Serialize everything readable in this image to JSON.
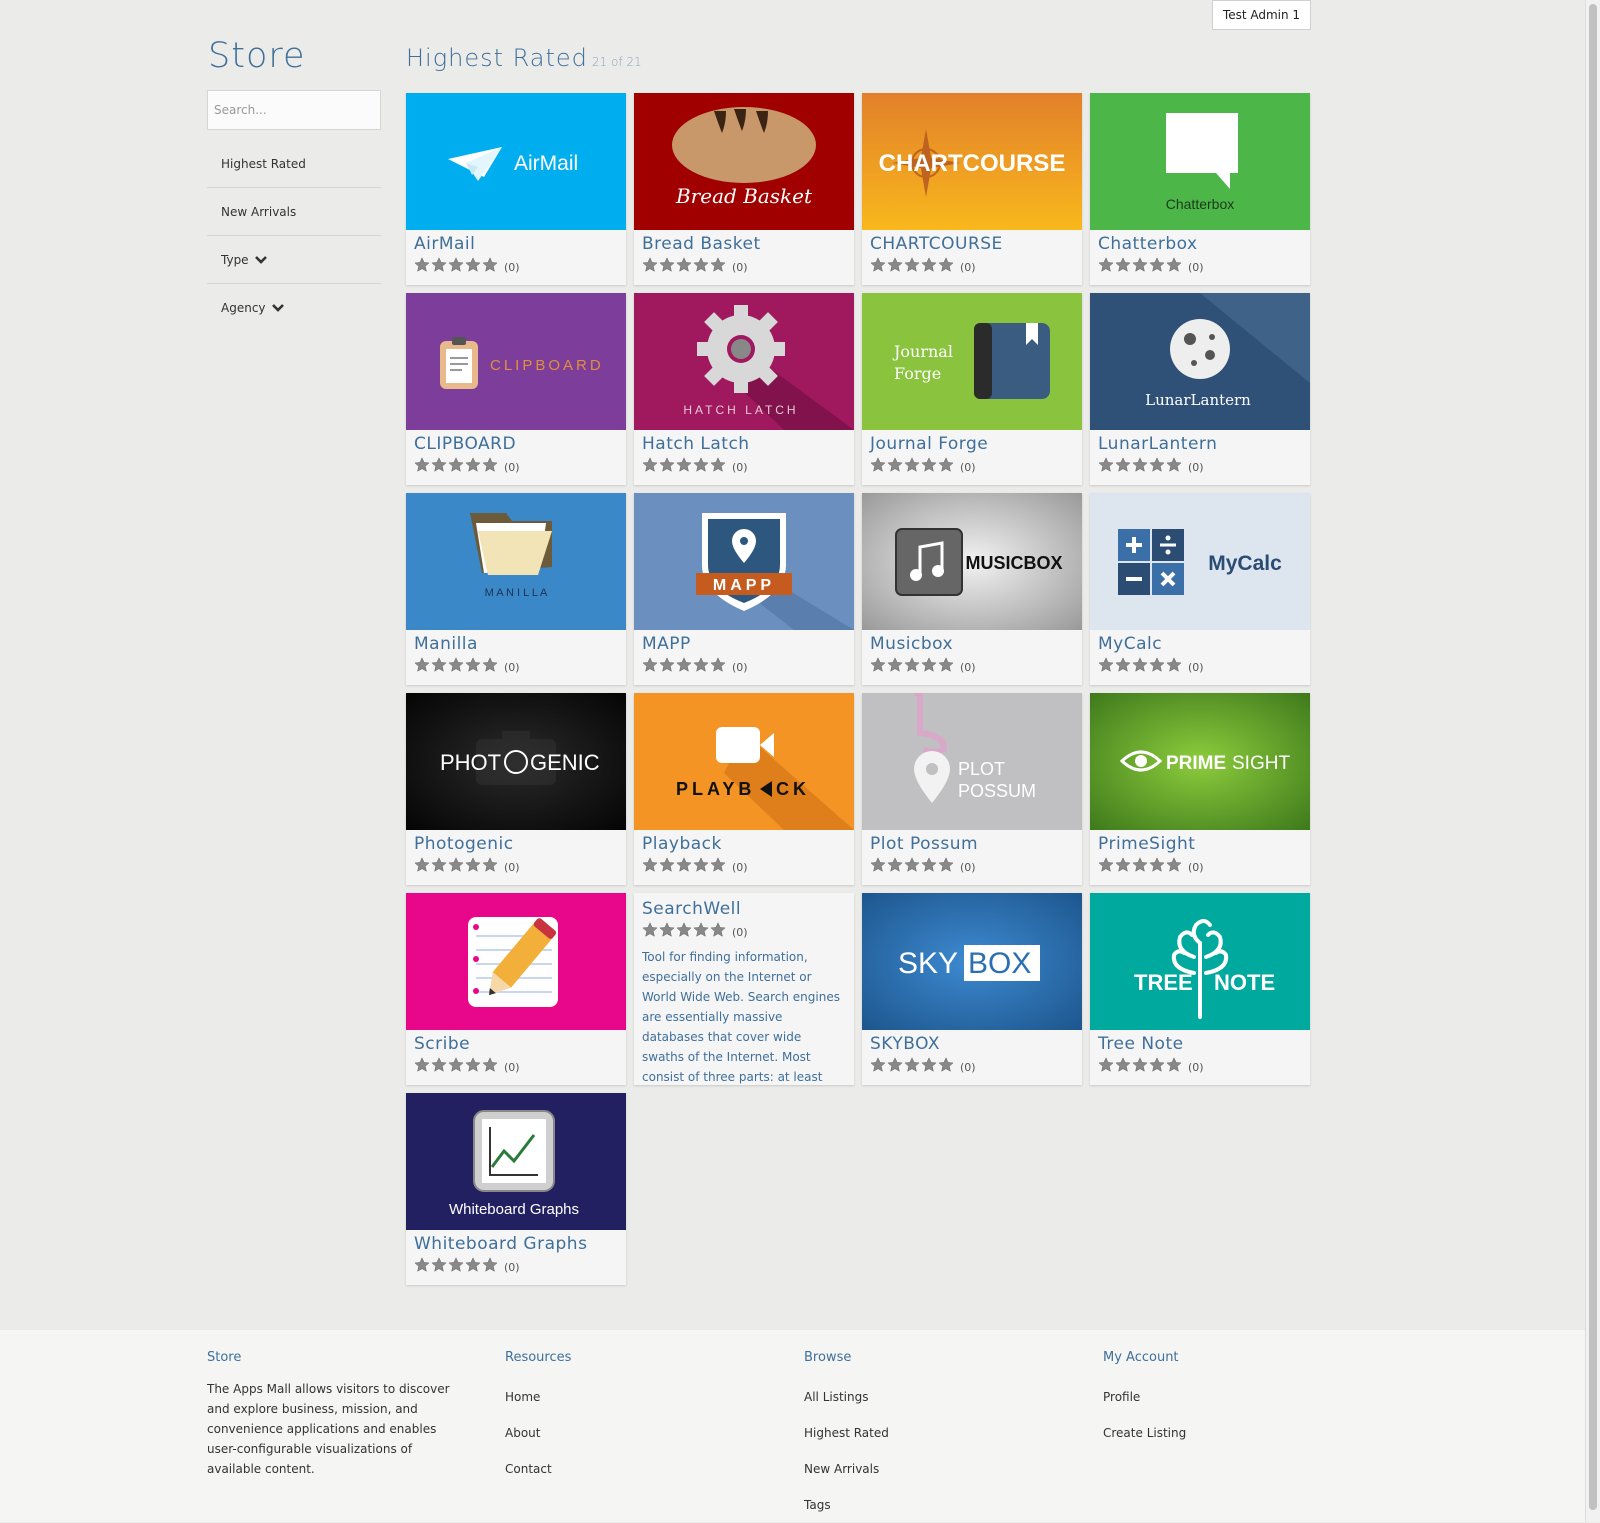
{
  "header": {
    "user_label": "Test Admin 1"
  },
  "sidebar": {
    "title": "Store",
    "search_placeholder": "Search...",
    "items": [
      {
        "label": "Highest Rated"
      },
      {
        "label": "New Arrivals"
      },
      {
        "label": "Type"
      },
      {
        "label": "Agency"
      }
    ]
  },
  "main": {
    "section_title": "Highest Rated",
    "count_label": "21 of 21",
    "listings": [
      {
        "name": "AirMail",
        "rating_count": "(0)",
        "stars": 0,
        "banner_text": "AirMail"
      },
      {
        "name": "Bread Basket",
        "rating_count": "(0)",
        "stars": 0,
        "banner_text": "Bread Basket"
      },
      {
        "name": "CHARTCOURSE",
        "rating_count": "(0)",
        "stars": 0,
        "banner_text": "CHARTCOURSE"
      },
      {
        "name": "Chatterbox",
        "rating_count": "(0)",
        "stars": 0,
        "banner_text": "Chatterbox"
      },
      {
        "name": "CLIPBOARD",
        "rating_count": "(0)",
        "stars": 0,
        "banner_text": "CLIPBOARD"
      },
      {
        "name": "Hatch Latch",
        "rating_count": "(0)",
        "stars": 0,
        "banner_text": "HATCH LATCH"
      },
      {
        "name": "Journal Forge",
        "rating_count": "(0)",
        "stars": 0,
        "banner_text_1": "Journal",
        "banner_text_2": "Forge"
      },
      {
        "name": "LunarLantern",
        "rating_count": "(0)",
        "stars": 0,
        "banner_text": "LunarLantern"
      },
      {
        "name": "Manilla",
        "rating_count": "(0)",
        "stars": 0,
        "banner_text": "M A N I L L A"
      },
      {
        "name": "MAPP",
        "rating_count": "(0)",
        "stars": 0,
        "banner_text": "MAPP"
      },
      {
        "name": "Musicbox",
        "rating_count": "(0)",
        "stars": 0,
        "banner_text": "MUSICBOX"
      },
      {
        "name": "MyCalc",
        "rating_count": "(0)",
        "stars": 0,
        "banner_text": "MyCalc"
      },
      {
        "name": "Photogenic",
        "rating_count": "(0)",
        "stars": 0,
        "banner_text_1": "PHOT",
        "banner_text_2": "GENIC"
      },
      {
        "name": "Playback",
        "rating_count": "(0)",
        "stars": 0,
        "banner_text_1": "PLAYB",
        "banner_text_2": "CK"
      },
      {
        "name": "Plot Possum",
        "rating_count": "(0)",
        "stars": 0,
        "banner_text_1": "PLOT",
        "banner_text_2": "POSSUM"
      },
      {
        "name": "PrimeSight",
        "rating_count": "(0)",
        "stars": 0,
        "banner_text_1": "PRIME",
        "banner_text_2": "SIGHT"
      },
      {
        "name": "Scribe",
        "rating_count": "(0)",
        "stars": 0
      },
      {
        "name": "SearchWell",
        "rating_count": "(0)",
        "stars": 0,
        "description": "Tool for finding information, especially on the Internet or World Wide Web. Search engines are essentially massive databases that cover wide swaths of the Internet. Most consist of three parts: at least"
      },
      {
        "name": "SKYBOX",
        "rating_count": "(0)",
        "stars": 0,
        "banner_text_1": "SKY",
        "banner_text_2": "BOX"
      },
      {
        "name": "Tree Note",
        "rating_count": "(0)",
        "stars": 0,
        "banner_text_1": "TREE",
        "banner_text_2": "NOTE"
      },
      {
        "name": "Whiteboard Graphs",
        "rating_count": "(0)",
        "stars": 0,
        "banner_text": "Whiteboard Graphs"
      }
    ]
  },
  "footer": {
    "store": {
      "heading": "Store",
      "text": "The Apps Mall allows visitors to discover and explore business, mission, and convenience applications and enables user-configurable visualizations of available content."
    },
    "resources": {
      "heading": "Resources",
      "links": [
        "Home",
        "About",
        "Contact"
      ]
    },
    "browse": {
      "heading": "Browse",
      "links": [
        "All Listings",
        "Highest Rated",
        "New Arrivals",
        "Tags"
      ]
    },
    "account": {
      "heading": "My Account",
      "links": [
        "Profile",
        "Create Listing"
      ]
    }
  },
  "colors": {
    "accent": "#3f6f9a",
    "airmail": "#00aeef",
    "breadbasket": "#a00000",
    "chartcourse": "#f0a020",
    "chatterbox": "#4cb648",
    "clipboard": "#7c3e9a",
    "hatchlatch": "#a0185e",
    "journalforge": "#8ac43f",
    "lunarlantern": "#2f5178",
    "manilla": "#3a88c8",
    "mapp": "#6b8fbf",
    "musicbox": "#b5b5b5",
    "mycalc": "#dde5ee",
    "photogenic": "#141414",
    "playback": "#f39424",
    "plotpossum": "#c0c0c2",
    "primesight": "#5a9a2a",
    "scribe": "#e8068b",
    "skybox": "#2a6fb0",
    "treenote": "#00a99d",
    "whiteboard": "#232062"
  }
}
